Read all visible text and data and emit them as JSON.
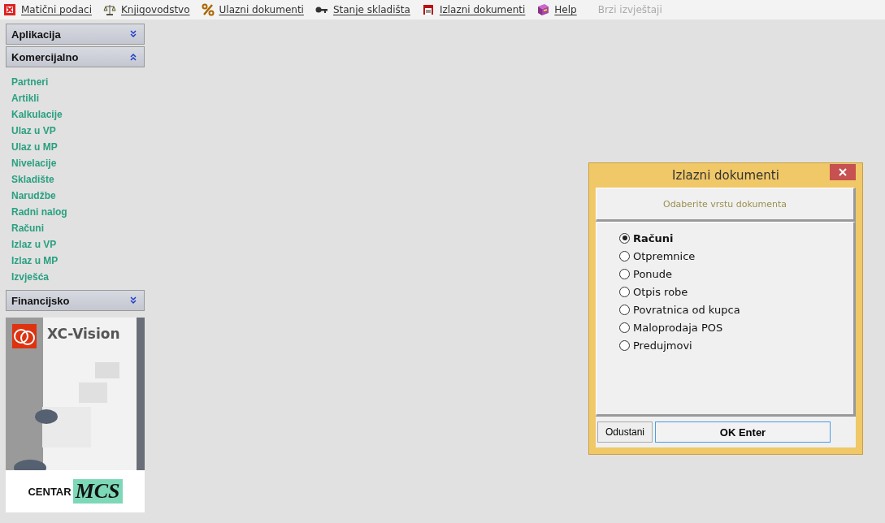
{
  "menu": [
    {
      "label": "Matični podaci",
      "disabled": false
    },
    {
      "label": "Knjigovodstvo",
      "disabled": false
    },
    {
      "label": "Ulazni dokumenti",
      "disabled": false
    },
    {
      "label": "Stanje skladišta",
      "disabled": false
    },
    {
      "label": "Izlazni dokumenti",
      "disabled": false
    },
    {
      "label": "Help",
      "disabled": false
    },
    {
      "label": "Brzi izvještaji",
      "disabled": true
    }
  ],
  "sidebar": {
    "sections": [
      {
        "title": "Aplikacija",
        "expanded": false
      },
      {
        "title": "Komercijalno",
        "expanded": true,
        "items": [
          "Partneri",
          "Artikli",
          "Kalkulacije",
          "Ulaz u VP",
          "Ulaz u MP",
          "Nivelacije",
          "Skladište",
          "Narudžbe",
          "Radni nalog",
          "Računi",
          "Izlaz u VP",
          "Izlaz u MP",
          "Izvješća"
        ]
      },
      {
        "title": "Financijsko",
        "expanded": false
      }
    ],
    "banner": {
      "product": "XC-Vision",
      "company": "CENTAR",
      "company_mark": "MCS"
    }
  },
  "dialog": {
    "title": "Izlazni dokumenti",
    "header": "Odaberite vrstu dokumenta",
    "options": [
      {
        "label": "Računi",
        "selected": true
      },
      {
        "label": "Otpremnice",
        "selected": false
      },
      {
        "label": "Ponude",
        "selected": false
      },
      {
        "label": "Otpis robe",
        "selected": false
      },
      {
        "label": "Povratnica od kupca",
        "selected": false
      },
      {
        "label": "Maloprodaja POS",
        "selected": false
      },
      {
        "label": "Predujmovi",
        "selected": false
      }
    ],
    "cancel": "Odustani",
    "ok": "OK Enter"
  }
}
